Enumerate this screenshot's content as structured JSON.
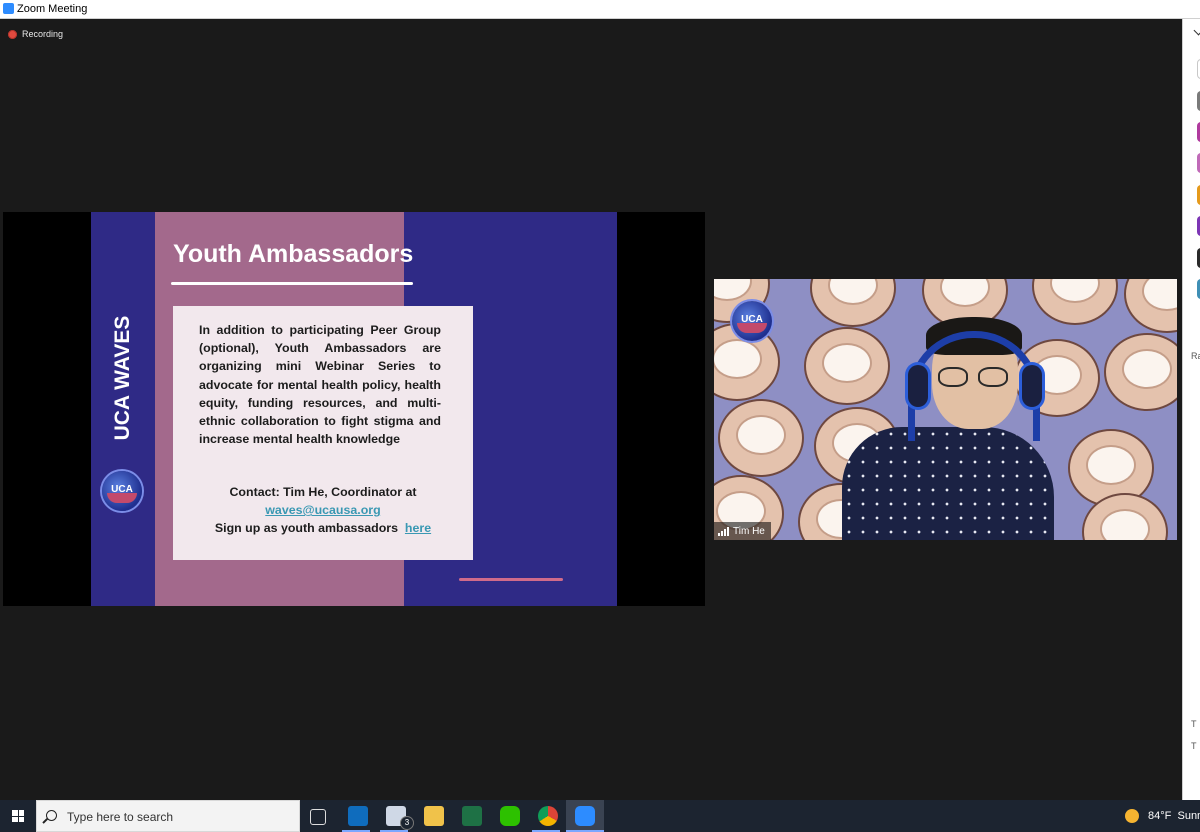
{
  "window": {
    "title": "Zoom Meeting"
  },
  "meeting": {
    "recording_label": "Recording",
    "participant_name": "Tim He"
  },
  "slide": {
    "vertical_title": "UCA WAVES",
    "logo_text": "UCA",
    "heading": "Youth Ambassadors",
    "body": "In addition to participating Peer Group (optional), Youth Ambassadors are organizing mini Webinar Series to advocate for mental health policy, health equity, funding resources, and multi-ethnic collaboration to fight stigma and increase mental health knowledge",
    "contact_line": "Contact:  Tim He, Coordinator at",
    "email": "waves@ucausa.org",
    "signup_text": "Sign up as youth ambassadors",
    "signup_link": "here"
  },
  "right_panel": {
    "labels": [
      "Ra",
      "T",
      "T"
    ]
  },
  "taskbar": {
    "search_placeholder": "Type here to search",
    "mail_badge": "3",
    "weather_temp": "84°F",
    "weather_text": "Sunn"
  },
  "colors": {
    "slide_navy": "#2f2a86",
    "slide_pink": "#a3698c",
    "link": "#3a98b3",
    "zoom_blue": "#2d8cff"
  }
}
